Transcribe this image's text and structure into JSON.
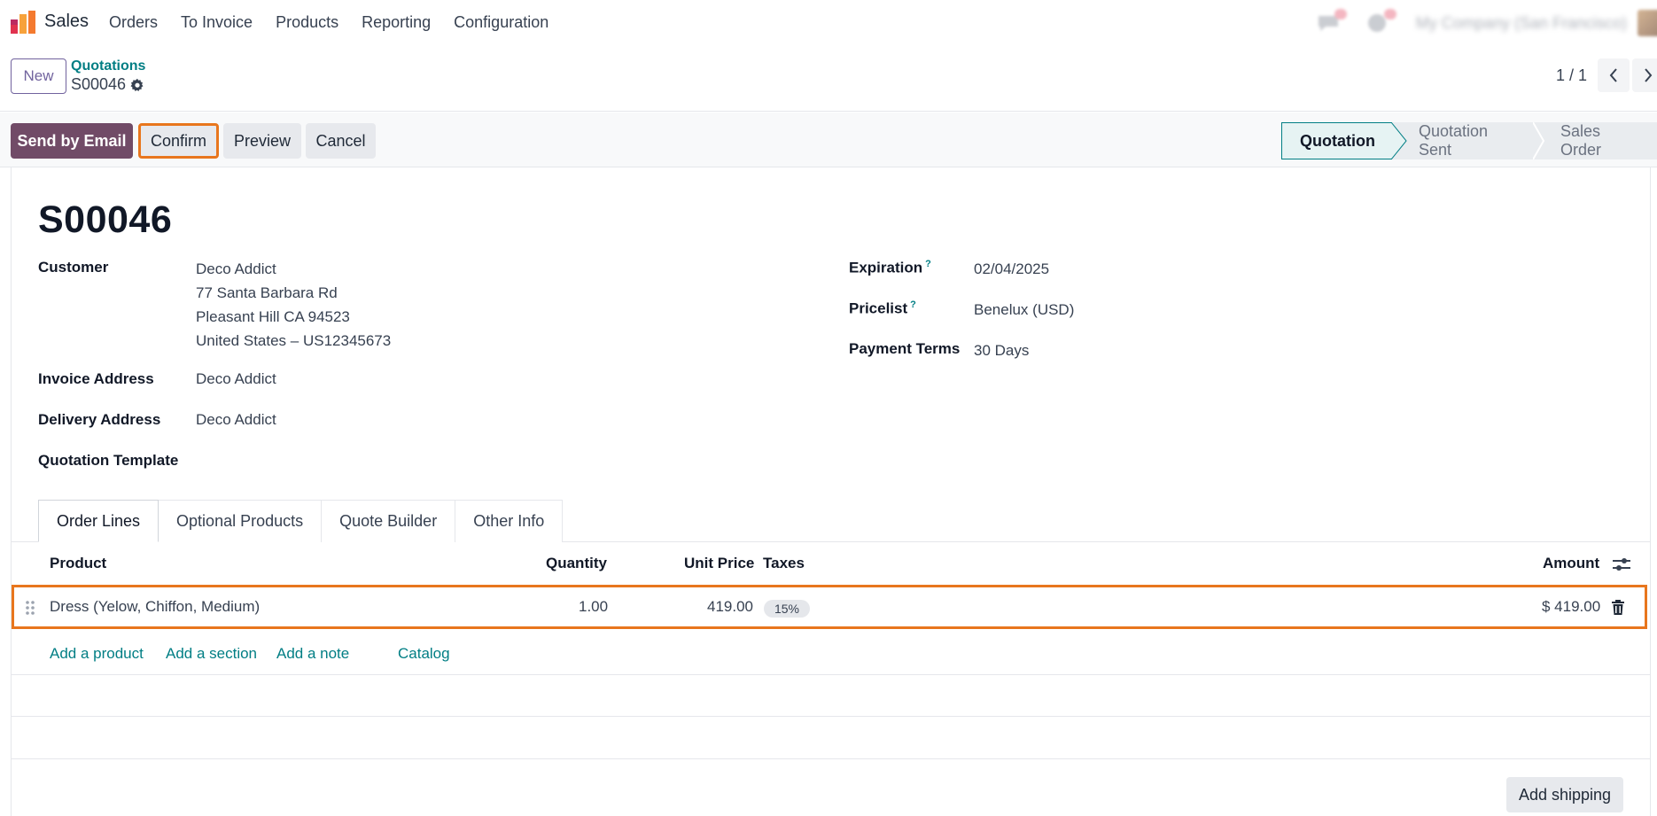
{
  "app": {
    "name": "Sales"
  },
  "nav": {
    "items": [
      "Orders",
      "To Invoice",
      "Products",
      "Reporting",
      "Configuration"
    ]
  },
  "systray": {
    "company": "My Company (San Francisco)"
  },
  "control": {
    "new_label": "New",
    "breadcrumb_parent": "Quotations",
    "record_name": "S00046",
    "pager": "1 / 1"
  },
  "actions": {
    "send_email": "Send by Email",
    "confirm": "Confirm",
    "preview": "Preview",
    "cancel": "Cancel"
  },
  "stages": [
    "Quotation",
    "Quotation Sent",
    "Sales Order"
  ],
  "form": {
    "title": "S00046",
    "customer_label": "Customer",
    "customer_lines": [
      "Deco Addict",
      "77 Santa Barbara Rd",
      "Pleasant Hill CA 94523",
      "United States – US12345673"
    ],
    "invoice_label": "Invoice Address",
    "invoice_value": "Deco Addict",
    "delivery_label": "Delivery Address",
    "delivery_value": "Deco Addict",
    "template_label": "Quotation Template",
    "expiration_label": "Expiration",
    "expiration_value": "02/04/2025",
    "pricelist_label": "Pricelist",
    "pricelist_value": "Benelux (USD)",
    "payment_label": "Payment Terms",
    "payment_value": "30 Days",
    "help_mark": "?"
  },
  "tabs": [
    "Order Lines",
    "Optional Products",
    "Quote Builder",
    "Other Info"
  ],
  "table": {
    "headers": {
      "product": "Product",
      "quantity": "Quantity",
      "unit_price": "Unit Price",
      "taxes": "Taxes",
      "amount": "Amount"
    },
    "rows": [
      {
        "product": "Dress (Yelow, Chiffon, Medium)",
        "quantity": "1.00",
        "unit_price": "419.00",
        "tax": "15%",
        "amount": "$ 419.00"
      }
    ],
    "links": {
      "add_product": "Add a product",
      "add_section": "Add a section",
      "add_note": "Add a note",
      "catalog": "Catalog"
    }
  },
  "footer": {
    "add_shipping": "Add shipping"
  },
  "colors": {
    "primary": "#714b67",
    "accent": "#017e84",
    "highlight": "#e8761d"
  }
}
